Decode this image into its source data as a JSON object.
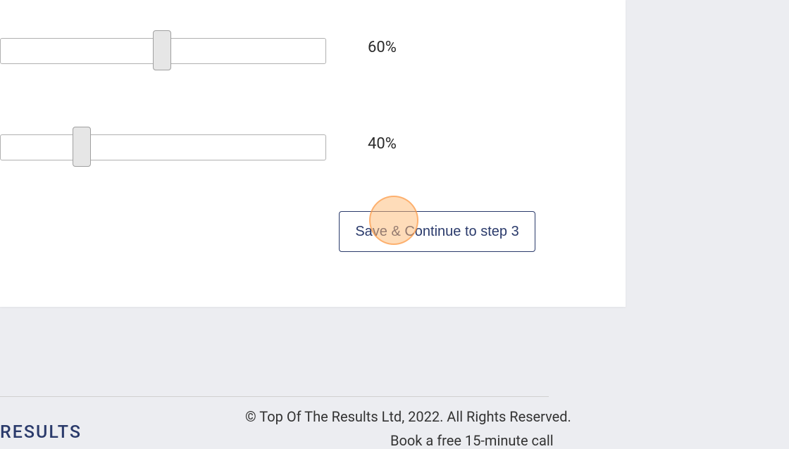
{
  "sliders": {
    "slider1": {
      "value_label": "60%",
      "value": 60
    },
    "slider2": {
      "value_label": "40%",
      "value": 40
    }
  },
  "actions": {
    "save_continue_label": "Save & Continue to step 3"
  },
  "footer": {
    "copyright": "© Top Of The Results Ltd, 2022. All Rights Reserved.",
    "cta": "Book a free 15-minute call",
    "logo_text": "RESULTS"
  }
}
